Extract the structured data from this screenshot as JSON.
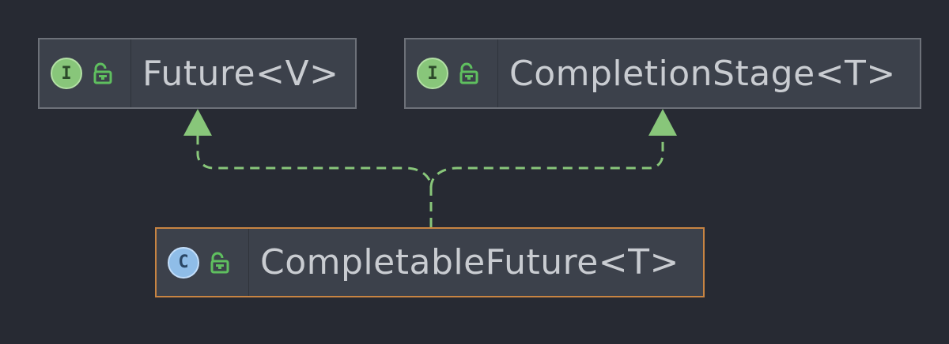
{
  "colors": {
    "background": "#272a33",
    "node_fill": "#3c414b",
    "node_border": "#6d7179",
    "selected_border": "#c88442",
    "edge": "#88c67a",
    "label_text": "#c9ccd1"
  },
  "nodes": [
    {
      "id": "future",
      "kind": "interface",
      "badge_letter": "I",
      "label": "Future<V>",
      "selected": false,
      "icons": [
        "interface-badge-icon",
        "unlocked-padlock-icon"
      ]
    },
    {
      "id": "completion-stage",
      "kind": "interface",
      "badge_letter": "I",
      "label": "CompletionStage<T>",
      "selected": false,
      "icons": [
        "interface-badge-icon",
        "unlocked-padlock-icon"
      ]
    },
    {
      "id": "completable-future",
      "kind": "class",
      "badge_letter": "C",
      "label": "CompletableFuture<T>",
      "selected": true,
      "icons": [
        "class-badge-icon",
        "unlocked-padlock-icon"
      ]
    }
  ],
  "edges": [
    {
      "from": "completable-future",
      "to": "future",
      "relation": "implements",
      "style": "dashed"
    },
    {
      "from": "completable-future",
      "to": "completion-stage",
      "relation": "implements",
      "style": "dashed"
    }
  ]
}
